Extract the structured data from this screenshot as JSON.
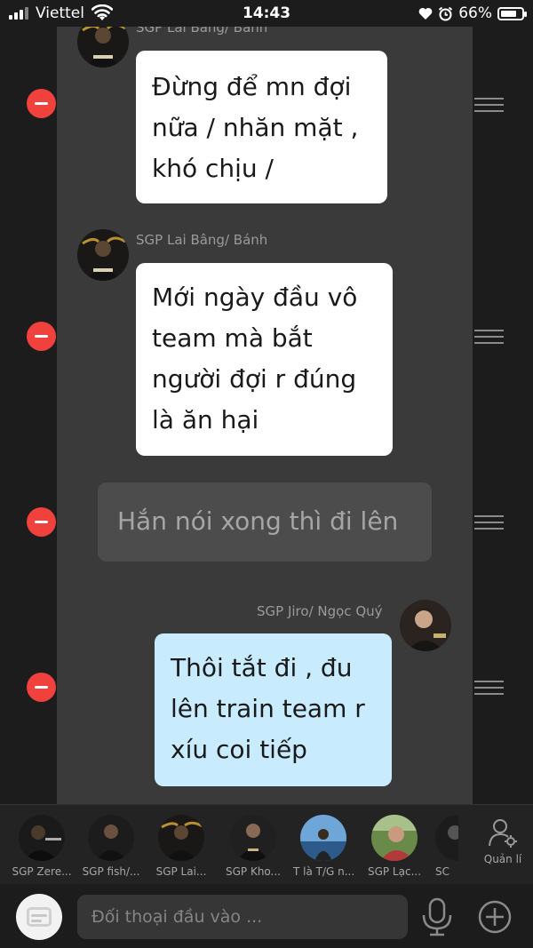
{
  "status_bar": {
    "carrier": "Viettel",
    "time": "14:43",
    "battery": "66%"
  },
  "messages": [
    {
      "sender": "SGP Lai Bâng/ Bánh",
      "text": "Đừng để mn đợi\nnữa / nhăn mặt ,\nkhó chịu /",
      "style": "white",
      "side": "left"
    },
    {
      "sender": "SGP Lai Bâng/ Bánh",
      "text": "Mới ngày đầu vô\nteam mà bắt\nngười đợi r đúng\nlà ăn hại",
      "style": "white",
      "side": "left"
    },
    {
      "sender": "",
      "text": "Hắn nói xong thì đi lên",
      "style": "dark",
      "side": "left"
    },
    {
      "sender": "SGP Jiro/ Ngọc Quý",
      "text": "Thôi tắt đi , đu\nlên train team r\nxíu coi tiếp",
      "style": "blue",
      "side": "right"
    }
  ],
  "members": [
    {
      "name": "SGP Zere..."
    },
    {
      "name": "SGP fish/..."
    },
    {
      "name": "SGP Lai..."
    },
    {
      "name": "SGP Kho..."
    },
    {
      "name": "T là T/G n..."
    },
    {
      "name": "SGP Lạc..."
    },
    {
      "name": "SC"
    }
  ],
  "manage_label": "Quản lí",
  "input": {
    "placeholder": "Đối thoại đầu vào ..."
  },
  "icons": {
    "remove": "remove-circle-icon",
    "drag": "drag-handle-icon",
    "mic": "microphone-icon",
    "plus": "add-circle-icon",
    "menu": "chat-menu-icon",
    "manage": "manage-members-icon"
  },
  "colors": {
    "remove_red": "#f0413c",
    "bubble_white": "#ffffff",
    "bubble_blue": "#c8ecfe",
    "bubble_dark": "#4c4c4c",
    "panel": "#3a3a3a",
    "background": "#1c1c1c"
  }
}
